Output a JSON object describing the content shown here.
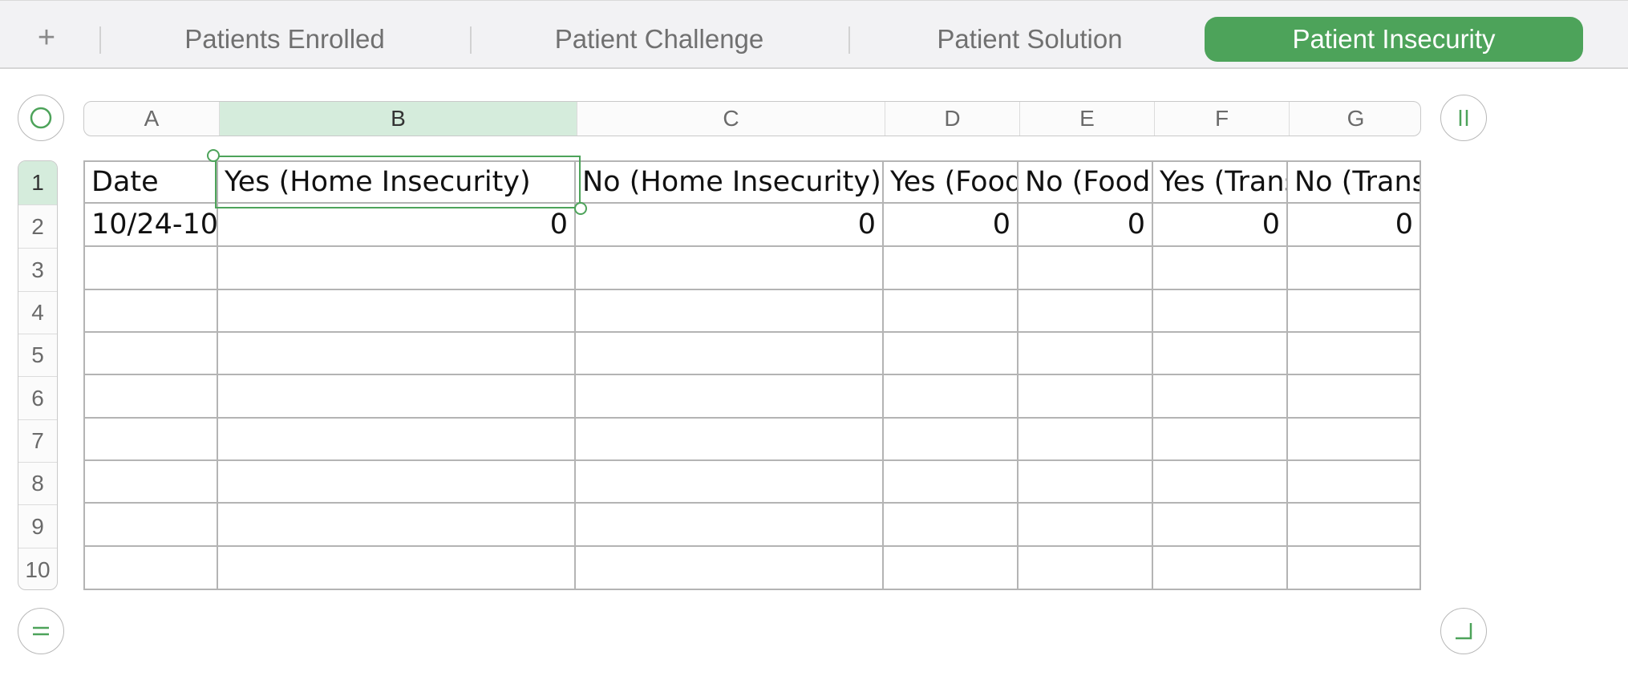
{
  "tabs": {
    "add_label": "+",
    "items": [
      {
        "label": "Patients Enrolled",
        "active": false
      },
      {
        "label": "Patient Challenge",
        "active": false
      },
      {
        "label": "Patient Solution",
        "active": false
      },
      {
        "label": "Patient Insecurity",
        "active": true
      }
    ]
  },
  "columns": [
    "A",
    "B",
    "C",
    "D",
    "E",
    "F",
    "G"
  ],
  "selected_column": "B",
  "rows": [
    "1",
    "2",
    "3",
    "4",
    "5",
    "6",
    "7",
    "8",
    "9",
    "10"
  ],
  "selected_row": "1",
  "table": {
    "header": [
      "Date",
      "Yes (Home Insecurity)",
      "No (Home Insecurity)",
      "Yes (Food",
      "No (Food",
      "Yes (Trans",
      "No (Trans"
    ],
    "row2": [
      "10/24-10",
      "0",
      "0",
      "0",
      "0",
      "0",
      "0"
    ]
  },
  "colors": {
    "accent": "#4da35a",
    "selection_fill": "#d5ecdc"
  },
  "icons": {
    "add_sheet": "plus-icon",
    "select_table": "circle-icon",
    "add_column": "pause-bars-icon",
    "add_row": "equals-icon",
    "resize": "corner-icon"
  }
}
